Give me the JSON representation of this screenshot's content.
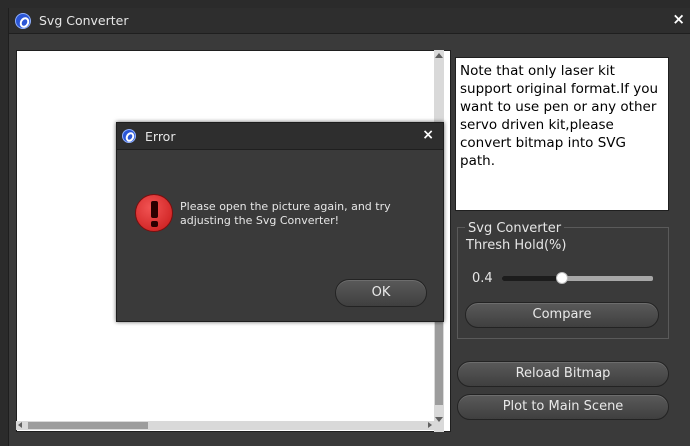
{
  "window": {
    "title": "Svg Converter",
    "close": "×"
  },
  "note": {
    "text": "Note that only laser kit support original format.If you want to use pen or any other servo driven kit,please convert bitmap into SVG path."
  },
  "settings": {
    "group_title": "Svg Converter",
    "thresh_label": "Thresh Hold(%)",
    "thresh_value": "0.4",
    "slider_fraction": 0.4,
    "compare_label": "Compare"
  },
  "actions": {
    "reload_label": "Reload Bitmap",
    "plot_label": "Plot to Main Scene"
  },
  "dialog": {
    "title": "Error",
    "close": "×",
    "message": "Please open the picture again, and try adjusting the Svg Converter!",
    "ok_label": "OK"
  },
  "colors": {
    "accent_icon": "#2b56d6",
    "error_red": "#d62020",
    "window_bg": "#3a3a3a"
  }
}
